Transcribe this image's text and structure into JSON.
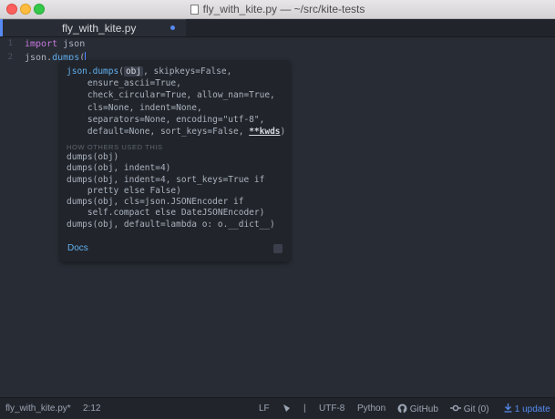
{
  "window": {
    "title": "fly_with_kite.py — ~/src/kite-tests"
  },
  "tabs": [
    {
      "label": "fly_with_kite.py",
      "modified": true
    }
  ],
  "editor": {
    "line_numbers": [
      "1",
      "2"
    ],
    "lines": [
      {
        "keyword": "import",
        "rest": " json"
      },
      {
        "prefix": "json.",
        "fn": "dumps",
        "rest": "("
      }
    ]
  },
  "kite_popup": {
    "signature": {
      "fn": "json.dumps",
      "open": "(",
      "first_param": "obj",
      "lines": [
        ", skipkeys=False,",
        "    ensure_ascii=True,",
        "    check_circular=True, allow_nan=True,",
        "    cls=None, indent=None,",
        "    separators=None, encoding=\"utf-8\",",
        "    default=None, sort_keys=False, "
      ],
      "kwargs": "**kwds",
      "close": ")"
    },
    "section_title": "HOW OTHERS USED THIS",
    "examples": [
      "dumps(obj)",
      "dumps(obj, indent=4)",
      "dumps(obj, indent=4, sort_keys=True if",
      "    pretty else False)",
      "dumps(obj, cls=json.JSONEncoder if",
      "    self.compact else DateJSONEncoder)",
      "dumps(obj, default=lambda o: o.__dict__)"
    ],
    "docs_label": "Docs"
  },
  "statusbar": {
    "file": "fly_with_kite.py*",
    "cursor": "2:12",
    "line_ending": "LF",
    "separator": "|",
    "encoding": "UTF-8",
    "grammar": "Python",
    "github": "GitHub",
    "git": "Git (0)",
    "update": "1 update"
  },
  "colors": {
    "accent": "#568af2",
    "editor_bg": "#282c34",
    "panel_bg": "#21252b"
  }
}
